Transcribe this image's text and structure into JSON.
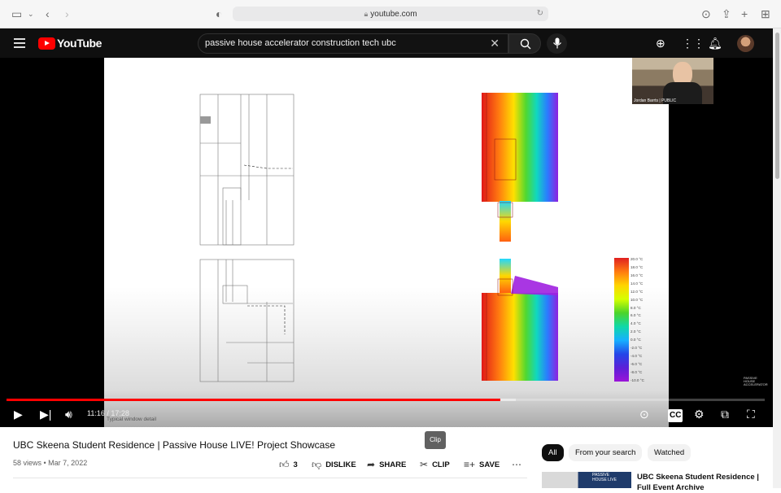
{
  "browser": {
    "url": "youtube.com"
  },
  "youtube": {
    "logo_text": "YouTube",
    "search_query": "passive house accelerator construction tech ubc"
  },
  "player": {
    "webcam_caption": "Jordan Barrts | PUBLIC",
    "scale_labels": [
      "20.0 °C",
      "18.0 °C",
      "16.0 °C",
      "14.0 °C",
      "12.0 °C",
      "10.0 °C",
      "8.0 °C",
      "6.0 °C",
      "4.0 °C",
      "2.0 °C",
      "0.0 °C",
      "-2.0 °C",
      "-4.0 °C",
      "-6.0 °C",
      "-8.0 °C",
      "-10.0 °C"
    ],
    "brand_mark": "PASSIVE HOUSE ACCELERATOR",
    "time": "11:16 / 17:28",
    "slide_caption": "Typical window detail",
    "played_fraction": 0.651,
    "buffered_fraction": 0.672,
    "tooltip": "Clip"
  },
  "video": {
    "title": "UBC Skeena Student Residence | Passive House LIVE! Project Showcase",
    "views": "58 views",
    "date": "Mar 7, 2022",
    "like_count": "3",
    "dislike_label": "DISLIKE",
    "share_label": "SHARE",
    "clip_label": "CLIP",
    "save_label": "SAVE"
  },
  "related": {
    "chips": [
      "All",
      "From your search",
      "Watched"
    ],
    "first_title": "UBC Skeena Student Residence | Full Event Archive",
    "thumb_text": "PASSIVE HOUSE LIVE"
  },
  "colors": {
    "youtube_red": "#ff0000",
    "header_bg": "#0f0f0f"
  }
}
